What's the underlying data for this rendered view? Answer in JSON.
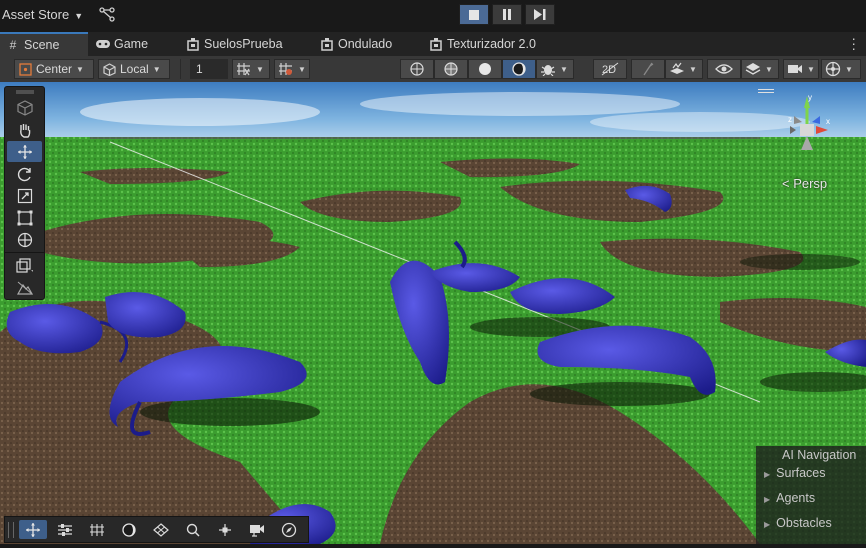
{
  "topbar": {
    "asset_store": "Asset Store",
    "dropdown_arrow": "▼",
    "icons": {
      "version_control": "branch-icon",
      "play": "play-icon",
      "pause": "pause-icon",
      "step": "step-icon"
    }
  },
  "tabs": [
    {
      "label": "Scene",
      "icon": "#",
      "active": true
    },
    {
      "label": "Game",
      "icon": "🎮"
    },
    {
      "label": "SuelosPrueba",
      "icon": "▣"
    },
    {
      "label": "Ondulado",
      "icon": "▣"
    },
    {
      "label": "Texturizador 2.0",
      "icon": "▣"
    }
  ],
  "toolbar": {
    "pivot_label": "Center",
    "space_label": "Local",
    "snap_value": "1",
    "dropdown_arrow": "▼"
  },
  "viewport": {
    "persp_label": "< Persp",
    "gizmo_labels": {
      "y": "y",
      "x": "x",
      "z": "z"
    }
  },
  "ai_navigation": {
    "title": "AI Navigation",
    "items": [
      "Surfaces",
      "Agents",
      "Obstacles"
    ],
    "arrow": "▶"
  },
  "colors": {
    "sky_top": "#4a86c8",
    "grass": "#3a9a2e",
    "soil": "#5e4a38",
    "shrimp": "#2e2ea8",
    "accent": "#3a79bb"
  }
}
